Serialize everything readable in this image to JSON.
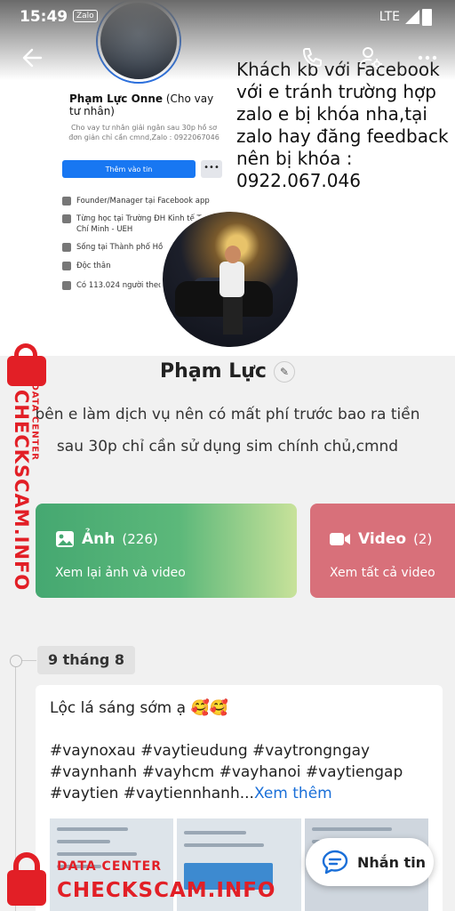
{
  "status_bar": {
    "time": "15:49",
    "app_badge": "Zalo",
    "network": "LTE"
  },
  "cover_image": {
    "fb_name": "Phạm Lực Onne",
    "fb_name_suffix": "(Cho vay tư nhân)",
    "fb_bio": "Cho vay tư nhân giải ngân sau 30p hồ sơ đơn giản chỉ cần cmnd,Zalo : 0922067046",
    "fb_button": "Thêm vào tin",
    "fb_more": "•••",
    "fb_rows": [
      "Founder/Manager tại Facebook app",
      "Từng học tại Trường ĐH Kinh tế TP Hồ Chí Minh - UEH",
      "Sống tại Thành phố Hồ",
      "Độc thân",
      "Có 113.024 người theo dõi"
    ],
    "overlay_text": "Khách kb với Facebook với e tránh trường hợp zalo e bị khóa nha,tại zalo hay đăng feedback nên bị khóa : 0922.067.046"
  },
  "profile": {
    "name": "Phạm Lực",
    "bio": "bên e làm dịch vụ nên có mất phí trước bao ra tiền sau 30p chỉ cần sử dụng sim chính chủ,cmnd"
  },
  "cards": {
    "photos": {
      "title": "Ảnh",
      "count": "(226)",
      "subtitle": "Xem lại ảnh và video",
      "color": "#45a871"
    },
    "videos": {
      "title": "Video",
      "count": "(2)",
      "subtitle": "Xem tất cả video",
      "color": "#d8707a"
    }
  },
  "timeline": {
    "date": "9 tháng 8",
    "post_text": "Lộc lá sáng sớm ạ 🥰🥰",
    "post_tags": "#vaynoxau #vaytieudung #vaytrongngay #vaynhanh #vayhcm #vayhanoi #vaytiengap #vaytien #vaytiennhanh...",
    "see_more": "Xem thêm"
  },
  "chat_button": {
    "label": "Nhắn tin"
  },
  "watermark": {
    "small": "DATA CENTER",
    "big": "CHECKSCAM.INFO",
    "color": "#e21f26"
  }
}
